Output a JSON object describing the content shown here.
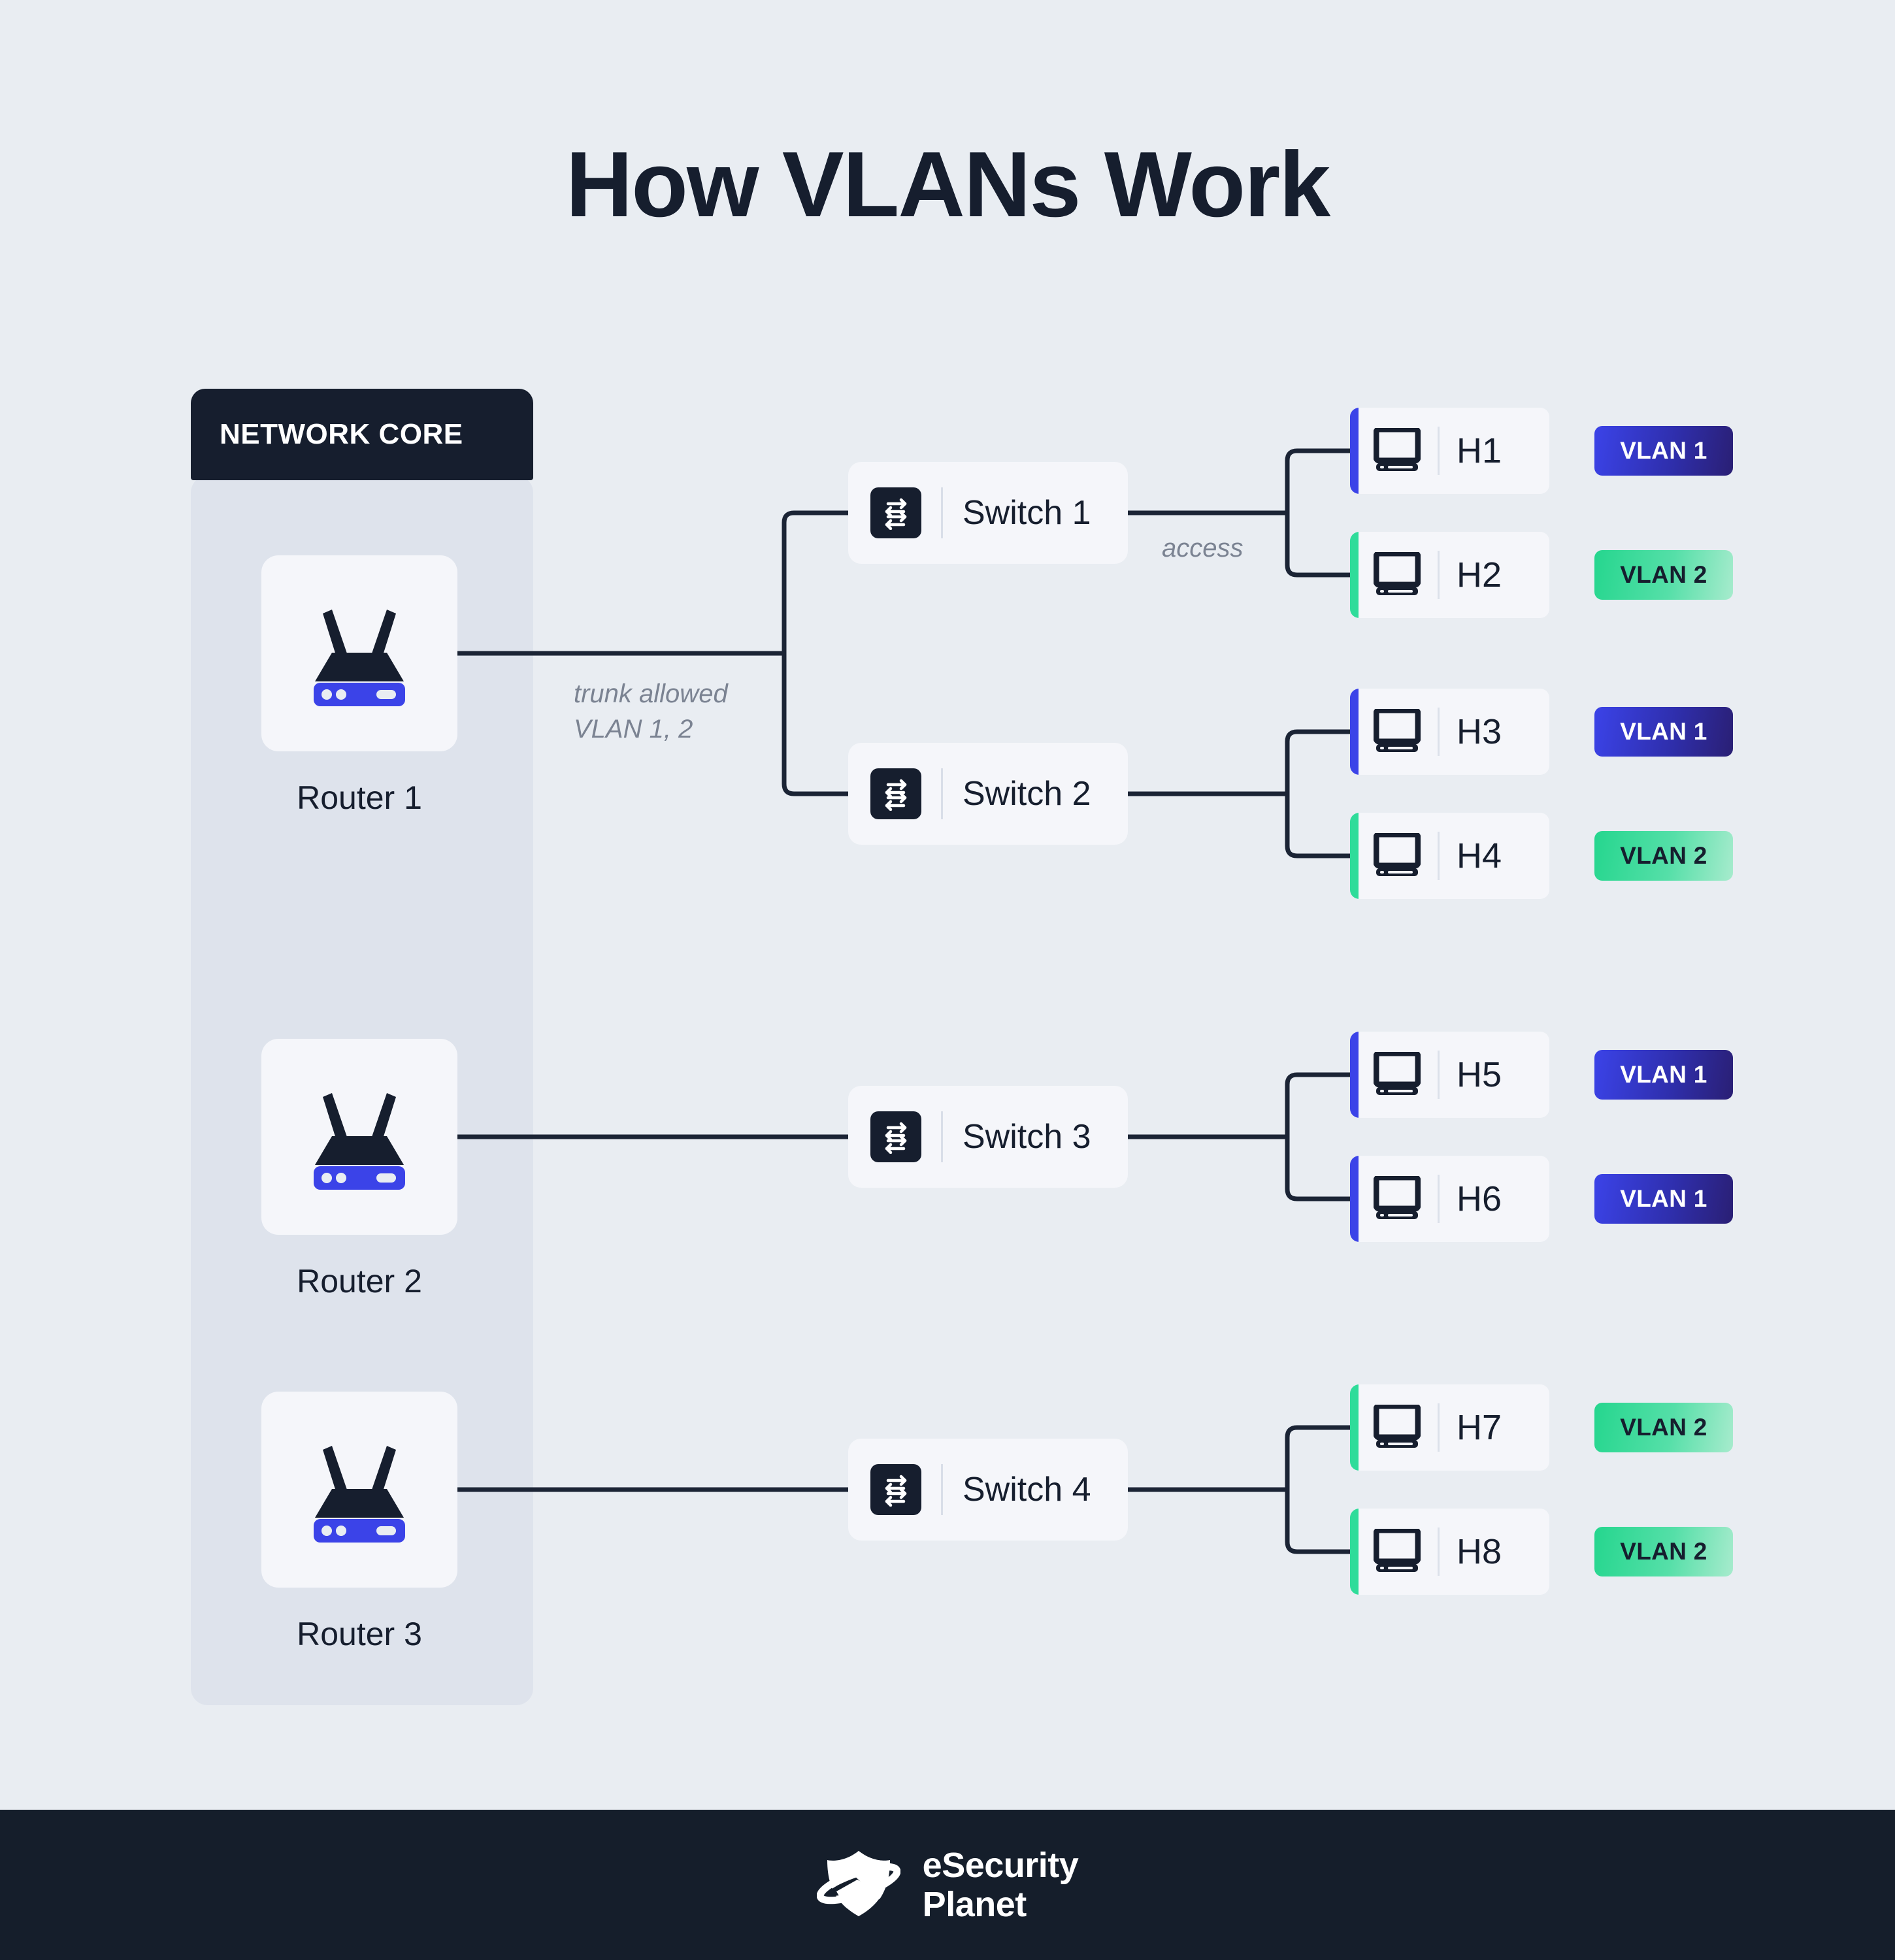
{
  "title": "How VLANs Work",
  "core": {
    "header_label": "NETWORK CORE"
  },
  "routers": [
    {
      "id": "router-1",
      "label": "Router 1",
      "icon": "router-icon"
    },
    {
      "id": "router-2",
      "label": "Router 2",
      "icon": "router-icon"
    },
    {
      "id": "router-3",
      "label": "Router 3",
      "icon": "router-icon"
    }
  ],
  "switches": [
    {
      "id": "switch-1",
      "label": "Switch 1",
      "icon": "switch-exchange-icon"
    },
    {
      "id": "switch-2",
      "label": "Switch 2",
      "icon": "switch-exchange-icon"
    },
    {
      "id": "switch-3",
      "label": "Switch 3",
      "icon": "switch-exchange-icon"
    },
    {
      "id": "switch-4",
      "label": "Switch 4",
      "icon": "switch-exchange-icon"
    }
  ],
  "hosts": [
    {
      "id": "h1",
      "label": "H1",
      "vlan": "VLAN 1",
      "vlan_key": "vlan1",
      "icon": "computer-icon"
    },
    {
      "id": "h2",
      "label": "H2",
      "vlan": "VLAN 2",
      "vlan_key": "vlan2",
      "icon": "computer-icon"
    },
    {
      "id": "h3",
      "label": "H3",
      "vlan": "VLAN 1",
      "vlan_key": "vlan1",
      "icon": "computer-icon"
    },
    {
      "id": "h4",
      "label": "H4",
      "vlan": "VLAN 2",
      "vlan_key": "vlan2",
      "icon": "computer-icon"
    },
    {
      "id": "h5",
      "label": "H5",
      "vlan": "VLAN 1",
      "vlan_key": "vlan1",
      "icon": "computer-icon"
    },
    {
      "id": "h6",
      "label": "H6",
      "vlan": "VLAN 1",
      "vlan_key": "vlan1",
      "icon": "computer-icon"
    },
    {
      "id": "h7",
      "label": "H7",
      "vlan": "VLAN 2",
      "vlan_key": "vlan2",
      "icon": "computer-icon"
    },
    {
      "id": "h8",
      "label": "H8",
      "vlan": "VLAN 2",
      "vlan_key": "vlan2",
      "icon": "computer-icon"
    }
  ],
  "edge_labels": {
    "trunk": "trunk allowed\nVLAN 1, 2",
    "access": "access"
  },
  "footer": {
    "brand_line1": "eSecurity",
    "brand_line2": "Planet",
    "logo_icon": "shield-planet-logo"
  },
  "colors": {
    "background": "#E9EDF2",
    "core_panel": "#DEE3EC",
    "dark": "#161E2E",
    "card": "#F5F6FA",
    "vlan1": "#3B43E8",
    "vlan2": "#2FDC9A",
    "line": "#1B2435",
    "muted_text": "#7B8392",
    "footer_bg": "#151E2B"
  }
}
